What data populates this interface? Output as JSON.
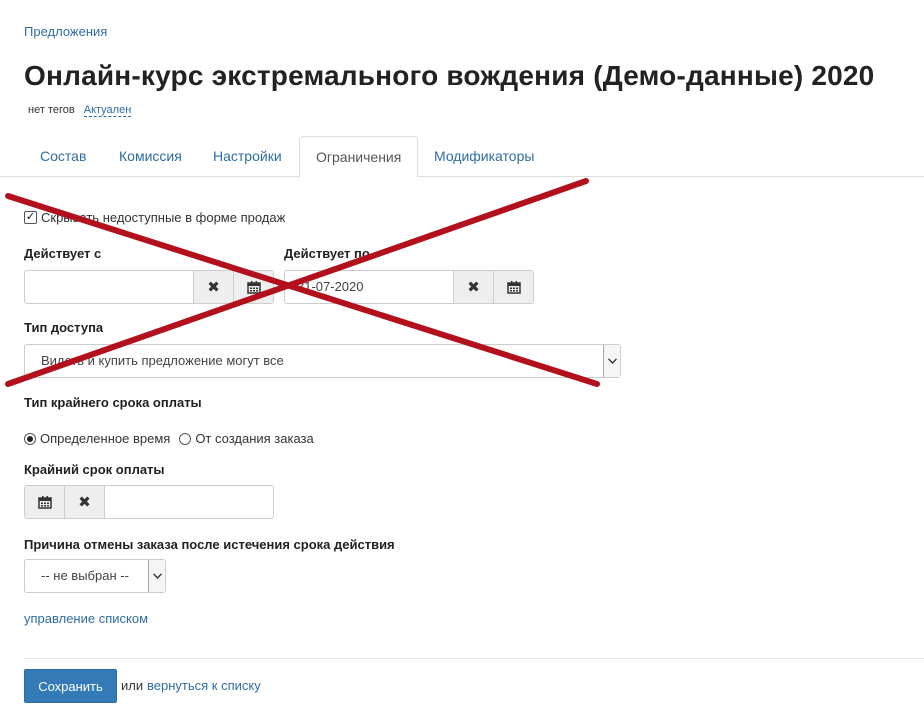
{
  "breadcrumb": {
    "label": "Предложения"
  },
  "page": {
    "title": "Онлайн-курс экстремального вождения (Демо-данные) 2020"
  },
  "meta": {
    "tags": "нет тегов",
    "status": "Актуален"
  },
  "tabs": [
    {
      "label": "Состав",
      "active": false
    },
    {
      "label": "Комиссия",
      "active": false
    },
    {
      "label": "Настройки",
      "active": false
    },
    {
      "label": "Ограничения",
      "active": true
    },
    {
      "label": "Модификаторы",
      "active": false
    }
  ],
  "form": {
    "hide_unavailable": {
      "label": "Скрывать недоступные в форме продаж",
      "checked": true
    },
    "valid_from": {
      "label": "Действует с",
      "value": ""
    },
    "valid_to": {
      "label": "Действует по",
      "value": "31-07-2020"
    },
    "access_type": {
      "label": "Тип доступа",
      "value": "Видеть и купить предложение могут все"
    },
    "payment_deadline_type": {
      "label": "Тип крайнего срока оплаты",
      "options": [
        {
          "label": "Определенное время",
          "selected": true
        },
        {
          "label": "От создания заказа",
          "selected": false
        }
      ]
    },
    "payment_deadline": {
      "label": "Крайний срок оплаты",
      "value": ""
    },
    "cancel_reason": {
      "label": "Причина отмены заказа после истечения срока действия",
      "value": "-- не выбран --"
    },
    "manage_list_link": "управление списком"
  },
  "footer": {
    "save_label": "Сохранить",
    "or_text": "или",
    "back_link": "вернуться к списку"
  },
  "icons": {
    "clear": "times-icon",
    "calendar": "calendar-icon",
    "dropdown": "chevron-down-icon"
  },
  "colors": {
    "primary": "#337ab7",
    "link": "#2e6da4",
    "cross": "#b3101e"
  }
}
